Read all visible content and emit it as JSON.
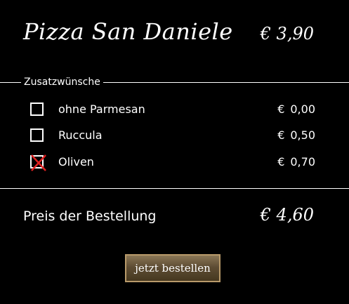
{
  "product": {
    "title": "Pizza San Daniele",
    "price": "€ 3,90"
  },
  "extras": {
    "legend": "Zusatzwünsche",
    "options": [
      {
        "label": "ohne Parmesan",
        "currency": "€",
        "price": "0,00",
        "checked": false
      },
      {
        "label": "Ruccula",
        "currency": "€",
        "price": "0,50",
        "checked": false
      },
      {
        "label": "Oliven",
        "currency": "€",
        "price": "0,70",
        "checked": true
      }
    ]
  },
  "total": {
    "label": "Preis der Bestellung",
    "price": "€ 4,60"
  },
  "order_button": {
    "label": "jetzt bestellen"
  },
  "colors": {
    "background": "#000000",
    "text": "#ffffff",
    "checkmark": "#e02020",
    "button_border": "#b89a6a"
  }
}
